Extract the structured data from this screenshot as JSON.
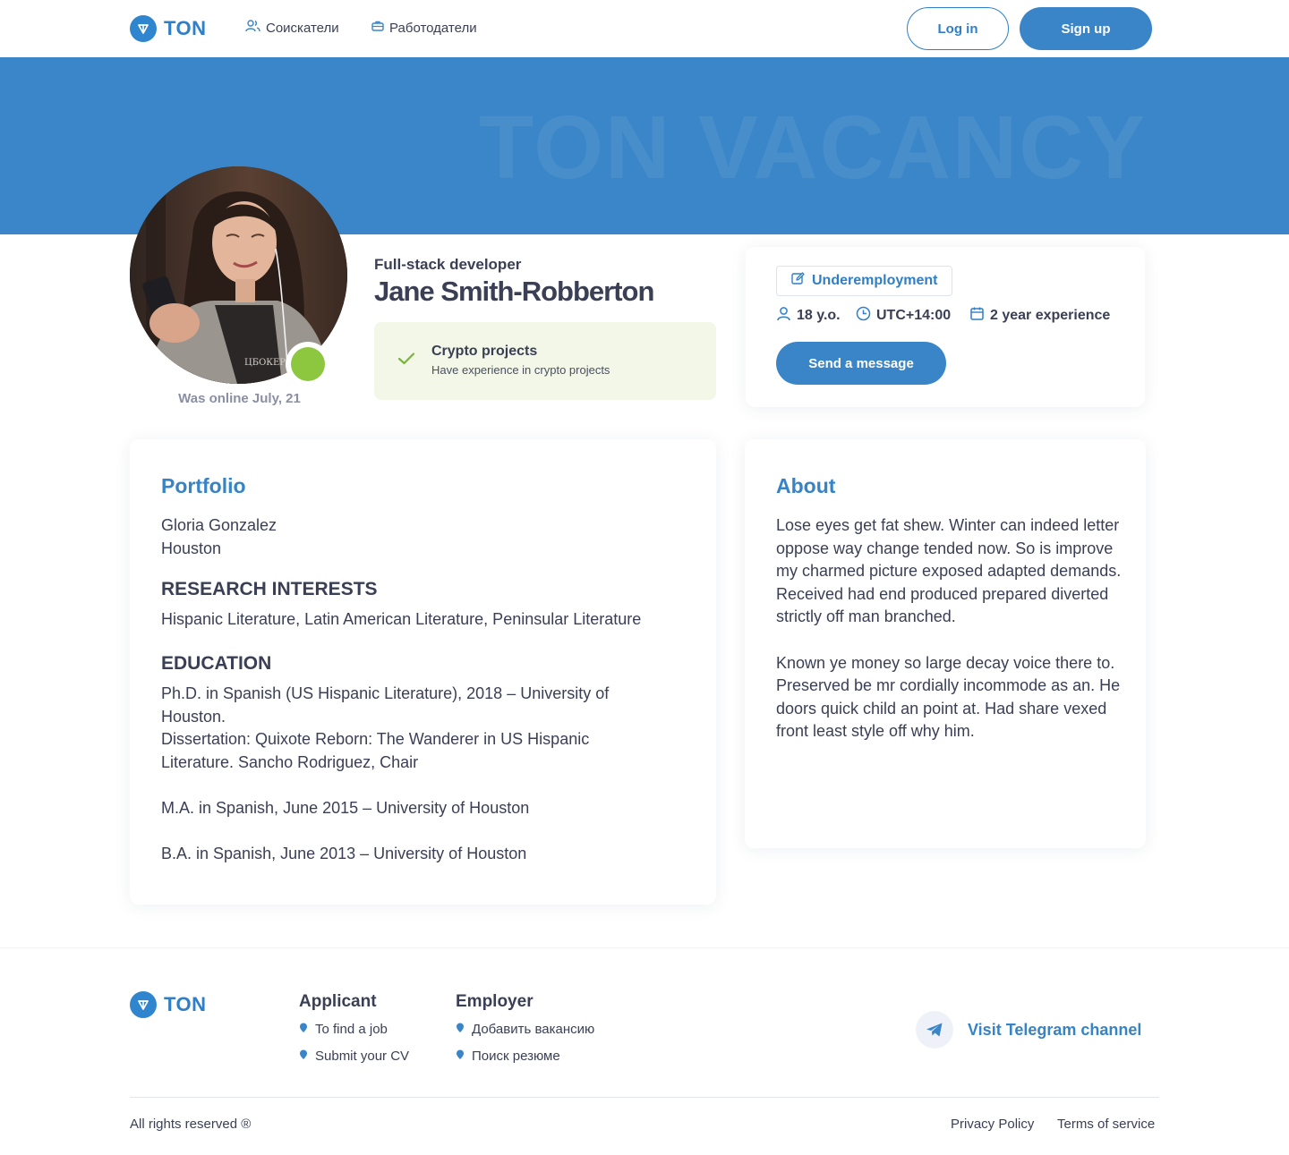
{
  "header": {
    "brand": "TON",
    "nav": [
      {
        "label": "Соискатели",
        "icon": "users-icon"
      },
      {
        "label": "Работодатели",
        "icon": "briefcase-icon"
      }
    ],
    "login_label": "Log in",
    "signup_label": "Sign up"
  },
  "banner": {
    "watermark": "TON VACANCY",
    "color": "#3b86c8"
  },
  "profile": {
    "role": "Full-stack developer",
    "name": "Jane Smith-Robberton",
    "online_text": "Was online July, 21",
    "online_status_color": "#8dc63f",
    "badge": {
      "title": "Crypto projects",
      "subtitle": "Have experience in crypto projects"
    }
  },
  "info": {
    "employment": "Underemployment",
    "age": "18 y.o.",
    "timezone": "UTC+14:00",
    "experience": "2 year experience",
    "message_button": "Send a message"
  },
  "portfolio": {
    "title": "Portfolio",
    "name_line": "Gloria Gonzalez",
    "city_line": "Houston",
    "research_heading": "RESEARCH INTERESTS",
    "research_text": "Hispanic Literature, Latin American Literature, Peninsular Literature",
    "education_heading": "EDUCATION",
    "education_1a": "Ph.D. in Spanish (US Hispanic Literature), 2018 – University of",
    "education_1b": "Houston.",
    "education_1c": "Dissertation: Quixote Reborn: The Wanderer in US Hispanic",
    "education_1d": "Literature. Sancho Rodriguez, Chair",
    "education_2": "M.A. in Spanish, June 2015 – University of Houston",
    "education_3": "B.A. in Spanish, June 2013 – University of Houston"
  },
  "about": {
    "title": "About",
    "text": "Lose eyes get fat shew. Winter can indeed letter oppose way change tended now. So is improve my charmed picture exposed adapted demands. Received had end produced prepared diverted strictly off man branched.\n\n Known ye money so large decay voice there to. Preserved be mr cordially incommode as an. He doors quick child an point at. Had share vexed front least style off why him."
  },
  "footer": {
    "brand": "TON",
    "applicant_title": "Applicant",
    "applicant_links": [
      "To find a job",
      "Submit your CV"
    ],
    "employer_title": "Employer",
    "employer_links": [
      "Добавить вакансию",
      "Поиск резюме"
    ],
    "telegram_label": "Visit Telegram channel",
    "rights": "All rights reserved ®",
    "privacy": "Privacy Policy",
    "terms": "Terms of service"
  },
  "colors": {
    "accent": "#3683c6",
    "button": "#3a85c8",
    "text": "#3a3f55",
    "badge_bg": "#f2f7e8"
  }
}
